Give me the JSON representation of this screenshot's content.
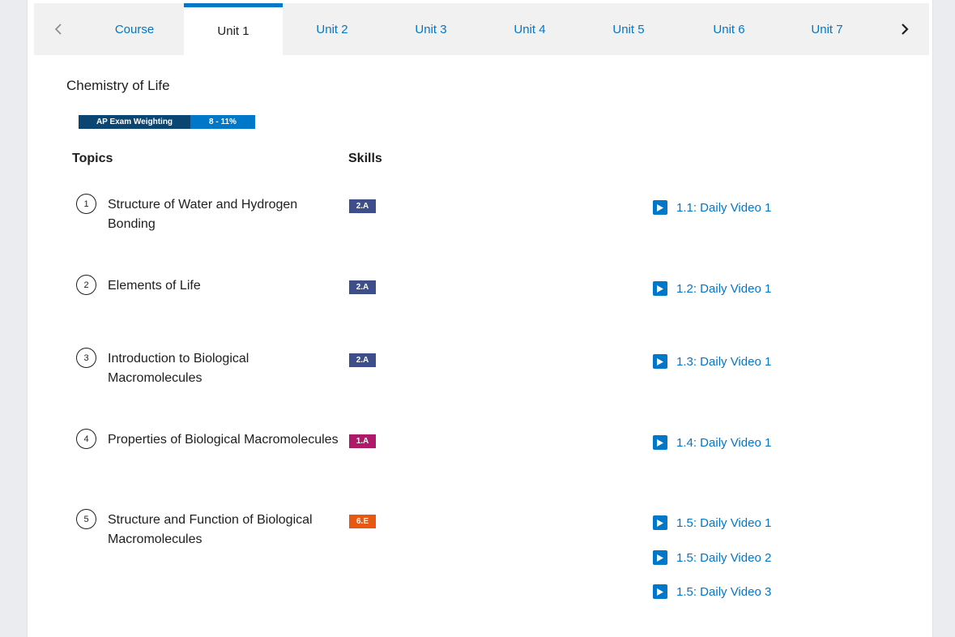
{
  "tabs": {
    "prev_arrow": "‹",
    "next_arrow": "›",
    "items": [
      {
        "label": "Course",
        "active": false
      },
      {
        "label": "Unit 1",
        "active": true
      },
      {
        "label": "Unit 2",
        "active": false
      },
      {
        "label": "Unit 3",
        "active": false
      },
      {
        "label": "Unit 4",
        "active": false
      },
      {
        "label": "Unit 5",
        "active": false
      },
      {
        "label": "Unit 6",
        "active": false
      },
      {
        "label": "Unit 7",
        "active": false
      }
    ]
  },
  "unit": {
    "title": "Chemistry of Life",
    "weighting_label": "AP Exam Weighting",
    "weighting_value": "8 - 11%"
  },
  "columns": {
    "topics": "Topics",
    "skills": "Skills"
  },
  "topics": [
    {
      "num": "1",
      "name": "Structure of Water and Hydrogen Bonding",
      "skill": "2.A",
      "skill_color": "#3d4e8a",
      "videos": [
        "1.1: Daily Video 1"
      ]
    },
    {
      "num": "2",
      "name": "Elements of Life",
      "skill": "2.A",
      "skill_color": "#3d4e8a",
      "videos": [
        "1.2: Daily Video 1"
      ]
    },
    {
      "num": "3",
      "name": "Introduction to Biological Macromolecules",
      "skill": "2.A",
      "skill_color": "#3d4e8a",
      "videos": [
        "1.3: Daily Video 1"
      ]
    },
    {
      "num": "4",
      "name": "Properties of Biological Macromolecules",
      "skill": "1.A",
      "skill_color": "#b0186a",
      "videos": [
        "1.4: Daily Video 1"
      ]
    },
    {
      "num": "5",
      "name": "Structure and Function of Biological Macromolecules",
      "skill": "6.E",
      "skill_color": "#e95811",
      "videos": [
        "1.5: Daily Video 1",
        "1.5: Daily Video 2",
        "1.5: Daily Video 3"
      ]
    }
  ],
  "icons": {
    "video": "play-icon",
    "prev": "chevron-left-icon",
    "next": "chevron-right-icon"
  },
  "colors": {
    "accent": "#0077c8",
    "weighting_dark": "#0b4672"
  }
}
